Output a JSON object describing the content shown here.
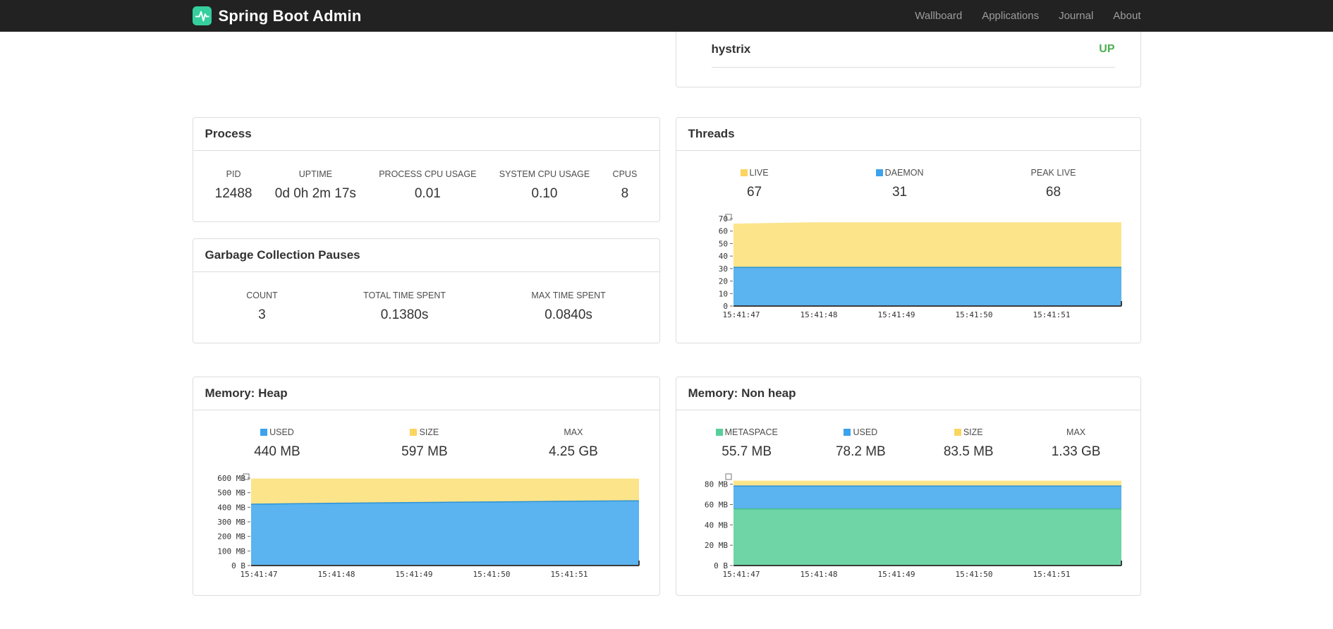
{
  "navbar": {
    "brand": "Spring Boot Admin",
    "brand_color": "#35cf9e",
    "items": [
      {
        "label": "Wallboard"
      },
      {
        "label": "Applications"
      },
      {
        "label": "Journal"
      },
      {
        "label": "About"
      }
    ]
  },
  "applications": {
    "rows": [
      {
        "name": "hystrix",
        "status": "UP",
        "status_color": "#4caf50"
      }
    ]
  },
  "panels": {
    "process": {
      "title": "Process",
      "metrics": [
        {
          "label": "PID",
          "value": "12488"
        },
        {
          "label": "UPTIME",
          "value": "0d 0h 2m 17s"
        },
        {
          "label": "PROCESS CPU USAGE",
          "value": "0.01"
        },
        {
          "label": "SYSTEM CPU USAGE",
          "value": "0.10"
        },
        {
          "label": "CPUS",
          "value": "8"
        }
      ]
    },
    "gc": {
      "title": "Garbage Collection Pauses",
      "metrics": [
        {
          "label": "COUNT",
          "value": "3"
        },
        {
          "label": "TOTAL TIME SPENT",
          "value": "0.1380s"
        },
        {
          "label": "MAX TIME SPENT",
          "value": "0.0840s"
        }
      ]
    },
    "threads": {
      "title": "Threads",
      "metrics": [
        {
          "label": "LIVE",
          "value": "67",
          "marker_color": "#fbd55f"
        },
        {
          "label": "DAEMON",
          "value": "31",
          "marker_color": "#3ba2ee"
        },
        {
          "label": "PEAK LIVE",
          "value": "68"
        }
      ]
    },
    "heap": {
      "title": "Memory: Heap",
      "metrics": [
        {
          "label": "USED",
          "value": "440 MB",
          "marker_color": "#3ba2ee"
        },
        {
          "label": "SIZE",
          "value": "597 MB",
          "marker_color": "#fbd55f"
        },
        {
          "label": "MAX",
          "value": "4.25 GB"
        }
      ]
    },
    "nonheap": {
      "title": "Memory: Non heap",
      "metrics": [
        {
          "label": "METASPACE",
          "value": "55.7 MB",
          "marker_color": "#57cf9c"
        },
        {
          "label": "USED",
          "value": "78.2 MB",
          "marker_color": "#3ba2ee"
        },
        {
          "label": "SIZE",
          "value": "83.5 MB",
          "marker_color": "#fbd55f"
        },
        {
          "label": "MAX",
          "value": "1.33 GB"
        }
      ]
    }
  },
  "chart_data": [
    {
      "id": "threads-chart",
      "type": "area",
      "title": "Threads",
      "x_labels": [
        "15:41:47",
        "15:41:48",
        "15:41:49",
        "15:41:50",
        "15:41:51"
      ],
      "ymax": 70,
      "yticks": [
        {
          "v": 0,
          "label": "0"
        },
        {
          "v": 10,
          "label": "10"
        },
        {
          "v": 20,
          "label": "20"
        },
        {
          "v": 30,
          "label": "30"
        },
        {
          "v": 40,
          "label": "40"
        },
        {
          "v": 50,
          "label": "50"
        },
        {
          "v": 60,
          "label": "60"
        },
        {
          "v": 70,
          "label": "70"
        }
      ],
      "series": [
        {
          "name": "LIVE",
          "color": "#fce48a",
          "stroke": "",
          "values": [
            66,
            67,
            67,
            67,
            67,
            67
          ]
        },
        {
          "name": "DAEMON",
          "color": "#5bb3ef",
          "stroke": "#2d93d6",
          "values": [
            31,
            31,
            31,
            31,
            31,
            31
          ]
        }
      ]
    },
    {
      "id": "heap-chart",
      "type": "area",
      "title": "Memory: Heap",
      "x_labels": [
        "15:41:47",
        "15:41:48",
        "15:41:49",
        "15:41:50",
        "15:41:51"
      ],
      "ymax": 600,
      "yticks": [
        {
          "v": 0,
          "label": "0 B"
        },
        {
          "v": 100,
          "label": "100 MB"
        },
        {
          "v": 200,
          "label": "200 MB"
        },
        {
          "v": 300,
          "label": "300 MB"
        },
        {
          "v": 400,
          "label": "400 MB"
        },
        {
          "v": 500,
          "label": "500 MB"
        },
        {
          "v": 600,
          "label": "600 MB"
        }
      ],
      "series": [
        {
          "name": "SIZE",
          "color": "#fce48a",
          "stroke": "",
          "values": [
            597,
            597,
            597,
            597,
            597,
            597
          ]
        },
        {
          "name": "USED",
          "color": "#5bb3ef",
          "stroke": "#2d93d6",
          "values": [
            421,
            427,
            432,
            436,
            441,
            444
          ]
        }
      ]
    },
    {
      "id": "nonheap-chart",
      "type": "area",
      "title": "Memory: Non heap",
      "x_labels": [
        "15:41:47",
        "15:41:48",
        "15:41:49",
        "15:41:50",
        "15:41:51"
      ],
      "ymax": 86,
      "yticks": [
        {
          "v": 0,
          "label": "0 B"
        },
        {
          "v": 20,
          "label": "20 MB"
        },
        {
          "v": 40,
          "label": "40 MB"
        },
        {
          "v": 60,
          "label": "60 MB"
        },
        {
          "v": 80,
          "label": "80 MB"
        }
      ],
      "series": [
        {
          "name": "SIZE",
          "color": "#fce48a",
          "stroke": "",
          "values": [
            83.5,
            83.5,
            83.5,
            83.5,
            83.5,
            83.5
          ]
        },
        {
          "name": "USED",
          "color": "#5bb3ef",
          "stroke": "#2d93d6",
          "values": [
            78.2,
            78.2,
            78.2,
            78.2,
            78.2,
            78.2
          ]
        },
        {
          "name": "METASPACE",
          "color": "#6fd5a6",
          "stroke": "#45c08d",
          "values": [
            55.7,
            55.7,
            55.7,
            55.7,
            55.7,
            55.7
          ]
        }
      ]
    }
  ]
}
